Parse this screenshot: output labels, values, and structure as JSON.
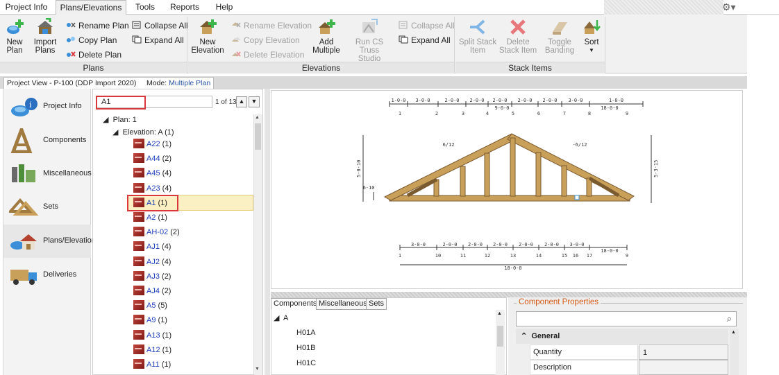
{
  "menu": {
    "items": [
      "Project Info",
      "Plans/Elevations",
      "Tools",
      "Reports",
      "Help"
    ],
    "active": "Plans/Elevations"
  },
  "ribbon": {
    "plans": {
      "label": "Plans",
      "new_plan": "New Plan",
      "import_plans": "Import Plans",
      "rename_plan": "Rename Plan",
      "copy_plan": "Copy Plan",
      "delete_plan": "Delete Plan",
      "collapse_all": "Collapse All",
      "expand_all": "Expand All"
    },
    "elevations": {
      "label": "Elevations",
      "new_elevation": "New Elevation",
      "rename_elevation": "Rename Elevation",
      "copy_elevation": "Copy Elevation",
      "delete_elevation": "Delete Elevation",
      "add_multiple": "Add Multiple",
      "run_cs_truss_studio": "Run CS Truss Studio",
      "collapse_all": "Collapse All",
      "expand_all": "Expand All"
    },
    "stack_items": {
      "label": "Stack Items",
      "split_stack_item": "Split Stack Item",
      "delete_stack_item": "Delete Stack Item",
      "toggle_banding": "Toggle Banding",
      "sort": "Sort"
    }
  },
  "project_view": {
    "tab_label": "Project View - P-100 (DDP Import 2020)",
    "mode_label": "Mode:",
    "mode_value": "Multiple Plan"
  },
  "nav": [
    "Project Info",
    "Components",
    "Miscellaneous",
    "Sets",
    "Plans/Elevations",
    "Deliveries"
  ],
  "nav_selected": "Plans/Elevations",
  "tree": {
    "search_value": "A1",
    "match_text": "1 of 13",
    "plan_node": "Plan:  1",
    "elevation_node": "Elevation:  A (1)",
    "items": [
      {
        "name": "A22",
        "count": "(1)"
      },
      {
        "name": "A44",
        "count": "(2)"
      },
      {
        "name": "A45",
        "count": "(4)"
      },
      {
        "name": "A23",
        "count": "(4)"
      },
      {
        "name": "A1",
        "count": "(1)"
      },
      {
        "name": "A2",
        "count": "(1)"
      },
      {
        "name": "AH-02",
        "count": "(2)"
      },
      {
        "name": "AJ1",
        "count": "(4)"
      },
      {
        "name": "AJ2",
        "count": "(4)"
      },
      {
        "name": "AJ3",
        "count": "(2)"
      },
      {
        "name": "AJ4",
        "count": "(2)"
      },
      {
        "name": "A5",
        "count": "(5)"
      },
      {
        "name": "A9",
        "count": "(1)"
      },
      {
        "name": "A13",
        "count": "(1)"
      },
      {
        "name": "A12",
        "count": "(1)"
      },
      {
        "name": "A11",
        "count": "(1)"
      }
    ],
    "selected": "A1"
  },
  "drawing": {
    "top_dims": [
      "1-0-0",
      "3-0-0",
      "2-0-0",
      "2-0-0",
      "2-0-0",
      "2-0-0",
      "2-0-0",
      "3-0-0",
      "1-0-0"
    ],
    "top_sub_dims": [
      "9-0-0",
      "18-0-0"
    ],
    "top_panel_nums": [
      "1",
      "2",
      "3",
      "4",
      "5",
      "6",
      "7",
      "8",
      "9"
    ],
    "left_pitch": "6/12",
    "right_pitch": "-6/12",
    "left_height": "5-0-10",
    "right_height": "5-3-15",
    "heel_height": "6-10",
    "bottom_dims": [
      "3-0-0",
      "2-0-0",
      "2-0-0",
      "2-0-0",
      "2-0-0",
      "2-0-0",
      "3-0-0"
    ],
    "bottom_sub_dim": "18-0-0",
    "bottom_panel_nums": [
      "1",
      "10",
      "11",
      "12",
      "13",
      "14",
      "15",
      "16",
      "17",
      "9"
    ],
    "overall_span": "18-0-0"
  },
  "components_panel": {
    "tabs": [
      "Components",
      "Miscellaneous",
      "Sets"
    ],
    "active_tab": "Components",
    "group": "A",
    "rows": [
      "H01A",
      "H01B",
      "H01C"
    ]
  },
  "properties": {
    "title": "Component Properties",
    "section": "General",
    "rows": [
      {
        "label": "Quantity",
        "value": "1"
      },
      {
        "label": "Description",
        "value": ""
      }
    ]
  },
  "colors": {
    "accent_red": "#d9363e",
    "selection_yellow": "#fbf0c3",
    "link_blue": "#1e3fbb",
    "props_orange": "#d35b1a",
    "timber": "#c9a05a"
  }
}
